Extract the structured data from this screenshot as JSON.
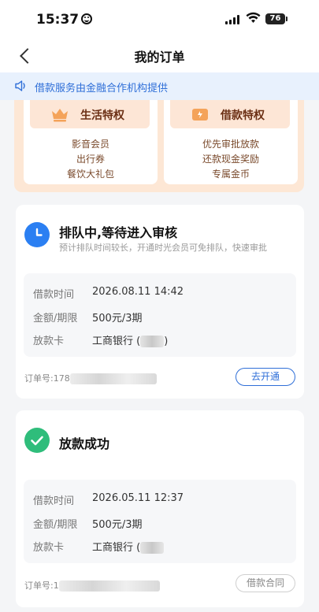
{
  "status_bar": {
    "time": "15:37",
    "battery": "76"
  },
  "nav": {
    "title": "我的订单"
  },
  "notice": {
    "text": "借款服务由金融合作机构提供"
  },
  "privileges": [
    {
      "title": "生活特权",
      "items": [
        "影音会员",
        "出行券",
        "餐饮大礼包"
      ]
    },
    {
      "title": "借款特权",
      "items": [
        "优先审批放款",
        "还款现金奖励",
        "专属金币"
      ]
    }
  ],
  "orders": [
    {
      "status_title": "排队中,等待进入审核",
      "status_sub": "预计排队时间较长，开通时光会员可免排队，快速审批",
      "rows": [
        {
          "label": "借款时间",
          "value": "2026.08.11 14:42"
        },
        {
          "label": "金额/期限",
          "value": "500元/3期"
        },
        {
          "label": "放款卡",
          "value": "工商银行 (",
          "suffix": ")"
        }
      ],
      "order_no_prefix": "订单号:178",
      "button": "去开通"
    },
    {
      "status_title": "放款成功",
      "rows": [
        {
          "label": "借款时间",
          "value": "2026.05.11 12:37"
        },
        {
          "label": "金额/期限",
          "value": "500元/3期"
        },
        {
          "label": "放款卡",
          "value": "工商银行 ("
        }
      ],
      "order_no_prefix": "订单号:1",
      "button": "借款合同"
    }
  ],
  "colors": {
    "accent": "#2f6fd8",
    "queue_icon": "#2b7ff2",
    "success_icon": "#2fbd7b",
    "privilege_bg": "#fde7d5"
  }
}
